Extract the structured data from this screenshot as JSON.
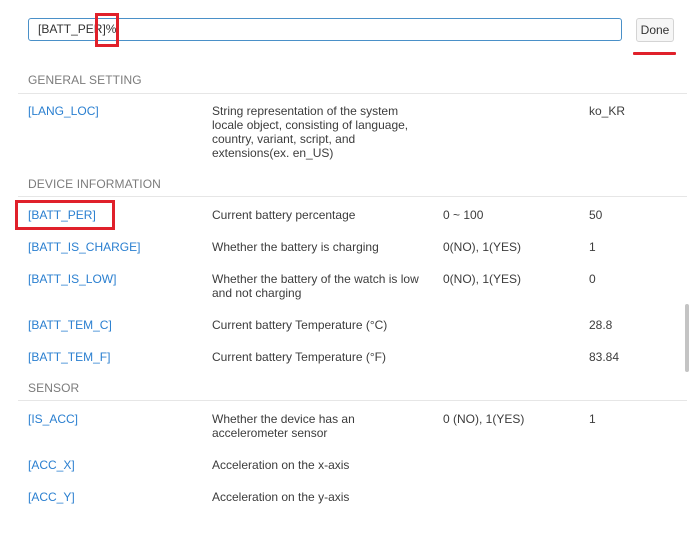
{
  "expression": {
    "value": "[BATT_PER]%",
    "done_label": "Done"
  },
  "sections": [
    {
      "title": "GENERAL SETTING",
      "rows": [
        {
          "key": "[LANG_LOC]",
          "description": "String representation of the system locale object, consisting of language, country, variant, script, and extensions(ex. en_US)",
          "range": "",
          "value": "ko_KR"
        }
      ]
    },
    {
      "title": "DEVICE INFORMATION",
      "rows": [
        {
          "key": "[BATT_PER]",
          "description": "Current battery percentage",
          "range": "0 ~ 100",
          "value": "50"
        },
        {
          "key": "[BATT_IS_CHARGE]",
          "description": "Whether the battery is charging",
          "range": "0(NO), 1(YES)",
          "value": "1"
        },
        {
          "key": "[BATT_IS_LOW]",
          "description": "Whether the battery of the watch is low and not charging",
          "range": "0(NO), 1(YES)",
          "value": "0"
        },
        {
          "key": "[BATT_TEM_C]",
          "description": "Current battery Temperature (°C)",
          "range": "",
          "value": "28.8"
        },
        {
          "key": "[BATT_TEM_F]",
          "description": "Current battery Temperature (°F)",
          "range": "",
          "value": "83.84"
        }
      ]
    },
    {
      "title": "SENSOR",
      "rows": [
        {
          "key": "[IS_ACC]",
          "description": "Whether the device has an accelerometer sensor",
          "range": "0 (NO), 1(YES)",
          "value": "1"
        },
        {
          "key": "[ACC_X]",
          "description": "Acceleration on the x-axis",
          "range": "",
          "value": ""
        },
        {
          "key": "[ACC_Y]",
          "description": "Acceleration on the y-axis",
          "range": "",
          "value": ""
        }
      ]
    }
  ],
  "colors": {
    "highlight": "#e0202a",
    "link": "#2a7fd0",
    "input_border": "#4a90c8"
  }
}
